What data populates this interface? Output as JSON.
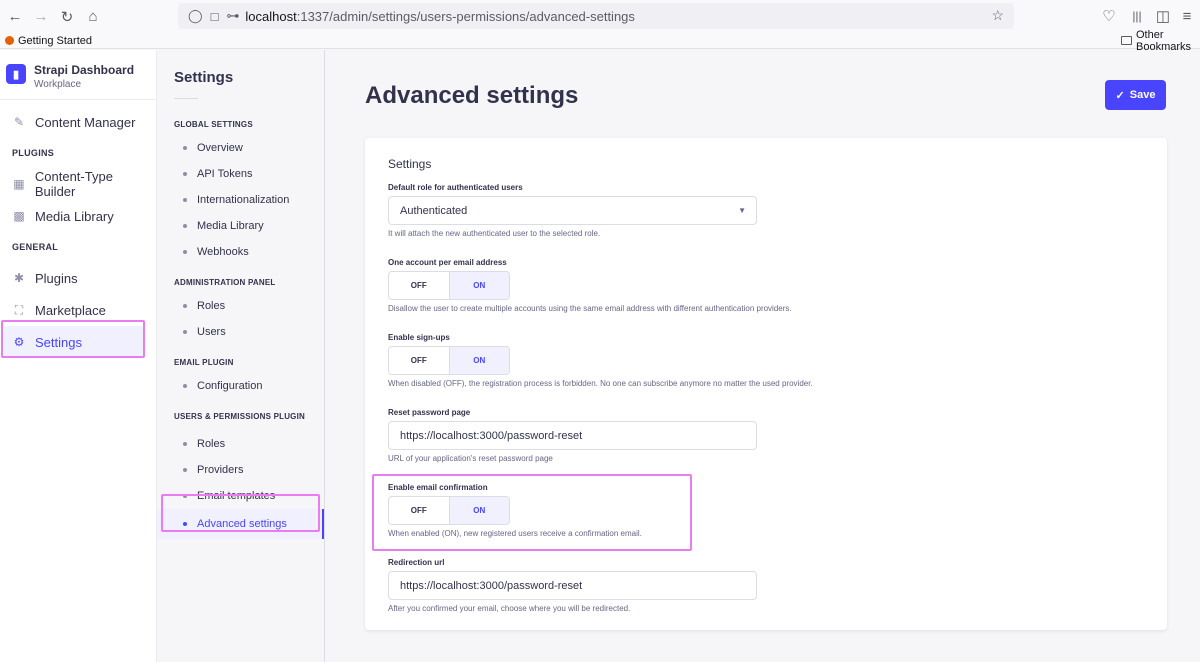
{
  "browser": {
    "url_host": "localhost",
    "url_path": ":1337/admin/settings/users-permissions/advanced-settings",
    "bookmark_left": "Getting Started",
    "bookmark_right": "Other Bookmarks"
  },
  "app": {
    "name": "Strapi Dashboard",
    "workspace": "Workplace"
  },
  "main_nav": {
    "content_manager": "Content Manager",
    "plugins_section": "PLUGINS",
    "content_type_builder": "Content-Type Builder",
    "media_library": "Media Library",
    "general_section": "GENERAL",
    "plugins": "Plugins",
    "marketplace": "Marketplace",
    "settings": "Settings"
  },
  "settings_nav": {
    "title": "Settings",
    "sections": [
      {
        "title": "GLOBAL SETTINGS",
        "items": [
          "Overview",
          "API Tokens",
          "Internationalization",
          "Media Library",
          "Webhooks"
        ]
      },
      {
        "title": "ADMINISTRATION PANEL",
        "items": [
          "Roles",
          "Users"
        ]
      },
      {
        "title": "EMAIL PLUGIN",
        "items": [
          "Configuration"
        ]
      },
      {
        "title": "USERS & PERMISSIONS PLUGIN",
        "items": [
          "Roles",
          "Providers",
          "Email templates",
          "Advanced settings"
        ]
      }
    ]
  },
  "page": {
    "title": "Advanced settings",
    "save_label": "Save"
  },
  "form": {
    "card_title": "Settings",
    "default_role": {
      "label": "Default role for authenticated users",
      "value": "Authenticated",
      "hint": "It will attach the new authenticated user to the selected role."
    },
    "one_account": {
      "label": "One account per email address",
      "off": "OFF",
      "on": "ON",
      "value": "ON",
      "hint": "Disallow the user to create multiple accounts using the same email address with different authentication providers."
    },
    "signups": {
      "label": "Enable sign-ups",
      "off": "OFF",
      "on": "ON",
      "value": "ON",
      "hint": "When disabled (OFF), the registration process is forbidden. No one can subscribe anymore no matter the used provider."
    },
    "reset_password": {
      "label": "Reset password page",
      "value": "https://localhost:3000/password-reset",
      "hint": "URL of your application's reset password page"
    },
    "email_confirmation": {
      "label": "Enable email confirmation",
      "off": "OFF",
      "on": "ON",
      "value": "ON",
      "hint": "When enabled (ON), new registered users receive a confirmation email."
    },
    "redirection": {
      "label": "Redirection url",
      "value": "https://localhost:3000/password-reset",
      "hint": "After you confirmed your email, choose where you will be redirected."
    }
  },
  "colors": {
    "primary": "#4945ff",
    "highlight": "#e97cf1"
  }
}
